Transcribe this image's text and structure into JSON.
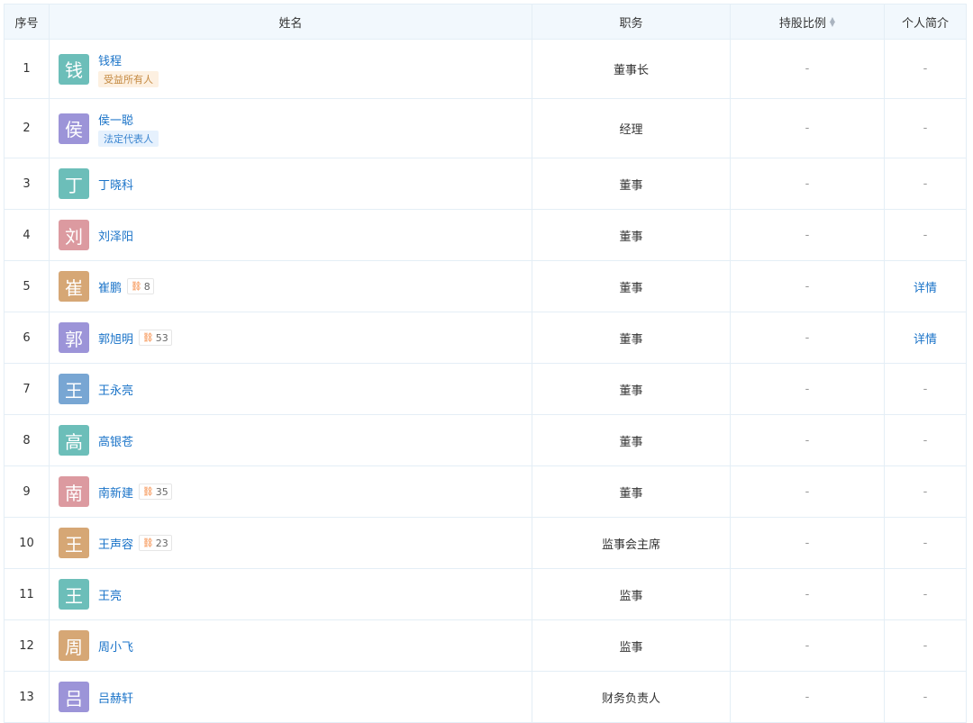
{
  "header": {
    "no": "序号",
    "name": "姓名",
    "position": "职务",
    "share": "持股比例",
    "bio": "个人简介"
  },
  "colors": {
    "teal": "#6cbeb9",
    "purple": "#9c94d8",
    "rose": "#dc9aa0",
    "tan": "#d6a775",
    "blue": "#78a6d3",
    "link": "#1a73c8",
    "relation_icon": "#f47a2a"
  },
  "rows": [
    {
      "no": "1",
      "avatar": "钱",
      "color": "#6cbeb9",
      "name": "钱程",
      "tag": "受益所有人",
      "tag_type": "ben",
      "rel": "",
      "position": "董事长",
      "share": "-",
      "bio": "-"
    },
    {
      "no": "2",
      "avatar": "侯",
      "color": "#9c94d8",
      "name": "侯一聪",
      "tag": "法定代表人",
      "tag_type": "legal",
      "rel": "",
      "position": "经理",
      "share": "-",
      "bio": "-"
    },
    {
      "no": "3",
      "avatar": "丁",
      "color": "#6cbeb9",
      "name": "丁晓科",
      "tag": "",
      "tag_type": "",
      "rel": "",
      "position": "董事",
      "share": "-",
      "bio": "-"
    },
    {
      "no": "4",
      "avatar": "刘",
      "color": "#dc9aa0",
      "name": "刘泽阳",
      "tag": "",
      "tag_type": "",
      "rel": "",
      "position": "董事",
      "share": "-",
      "bio": "-"
    },
    {
      "no": "5",
      "avatar": "崔",
      "color": "#d6a775",
      "name": "崔鹏",
      "tag": "",
      "tag_type": "",
      "rel": "8",
      "position": "董事",
      "share": "-",
      "bio": "详情"
    },
    {
      "no": "6",
      "avatar": "郭",
      "color": "#9c94d8",
      "name": "郭旭明",
      "tag": "",
      "tag_type": "",
      "rel": "53",
      "position": "董事",
      "share": "-",
      "bio": "详情"
    },
    {
      "no": "7",
      "avatar": "王",
      "color": "#78a6d3",
      "name": "王永亮",
      "tag": "",
      "tag_type": "",
      "rel": "",
      "position": "董事",
      "share": "-",
      "bio": "-"
    },
    {
      "no": "8",
      "avatar": "高",
      "color": "#6cbeb9",
      "name": "高银苍",
      "tag": "",
      "tag_type": "",
      "rel": "",
      "position": "董事",
      "share": "-",
      "bio": "-"
    },
    {
      "no": "9",
      "avatar": "南",
      "color": "#dc9aa0",
      "name": "南新建",
      "tag": "",
      "tag_type": "",
      "rel": "35",
      "position": "董事",
      "share": "-",
      "bio": "-"
    },
    {
      "no": "10",
      "avatar": "王",
      "color": "#d6a775",
      "name": "王声容",
      "tag": "",
      "tag_type": "",
      "rel": "23",
      "position": "监事会主席",
      "share": "-",
      "bio": "-"
    },
    {
      "no": "11",
      "avatar": "王",
      "color": "#6cbeb9",
      "name": "王亮",
      "tag": "",
      "tag_type": "",
      "rel": "",
      "position": "监事",
      "share": "-",
      "bio": "-"
    },
    {
      "no": "12",
      "avatar": "周",
      "color": "#d6a775",
      "name": "周小飞",
      "tag": "",
      "tag_type": "",
      "rel": "",
      "position": "监事",
      "share": "-",
      "bio": "-"
    },
    {
      "no": "13",
      "avatar": "吕",
      "color": "#9c94d8",
      "name": "吕赫轩",
      "tag": "",
      "tag_type": "",
      "rel": "",
      "position": "财务负责人",
      "share": "-",
      "bio": "-"
    }
  ]
}
